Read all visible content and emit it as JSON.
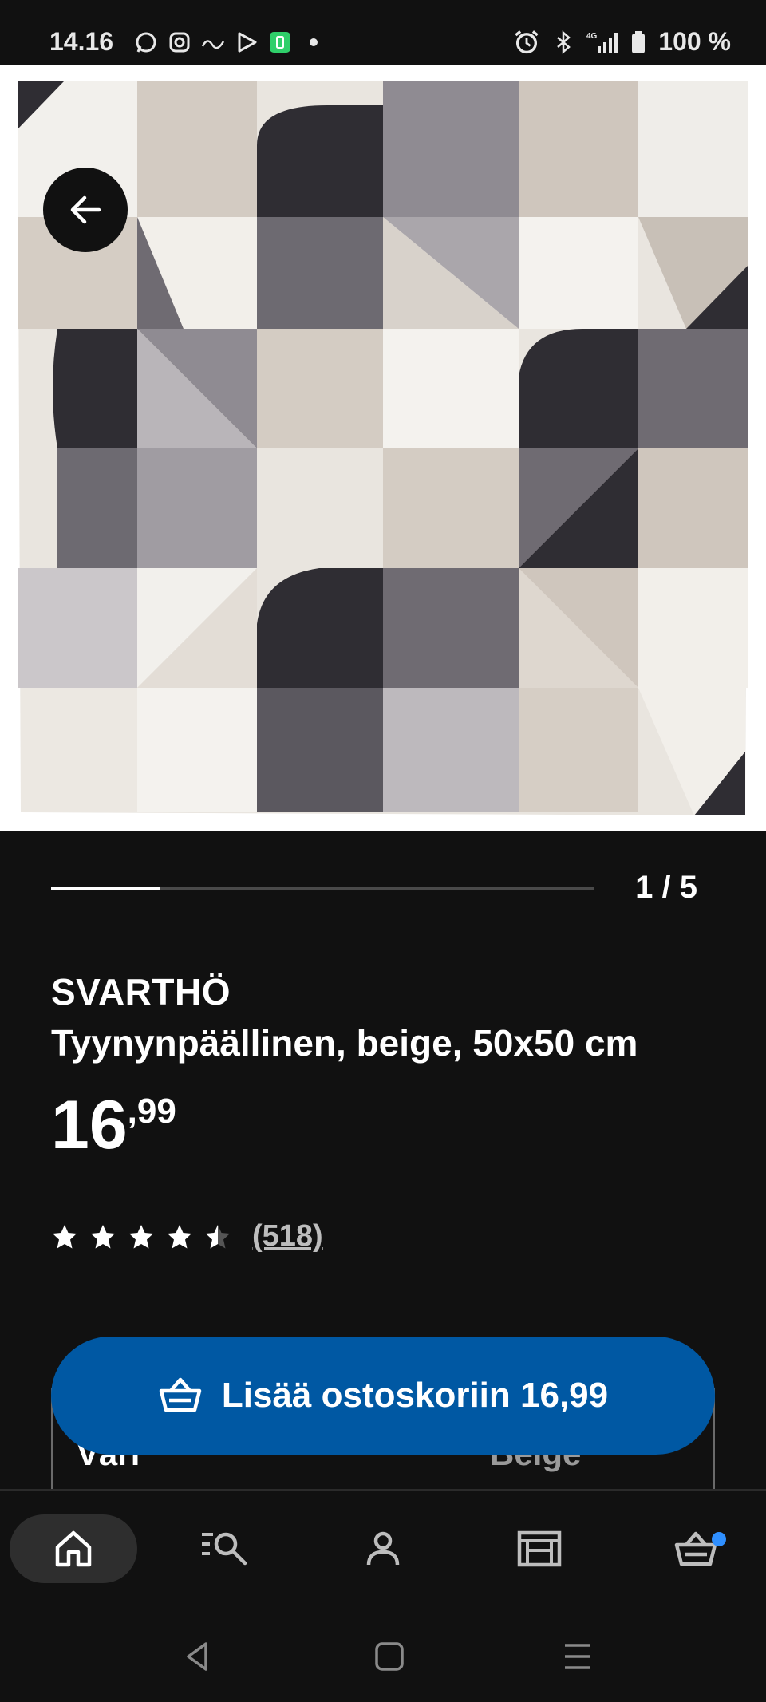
{
  "status_bar": {
    "time": "14.16",
    "left_icons": [
      "whatsapp-icon",
      "instagram-icon",
      "elisa-icon",
      "play-store-icon",
      "battery-saver-icon",
      "dot-icon"
    ],
    "right_icons": [
      "alarm-icon",
      "bluetooth-icon",
      "4g-signal-icon",
      "battery-icon"
    ],
    "network": "4G",
    "battery": "100 %"
  },
  "image": {
    "alt": "SVARTHÖ",
    "carousel_index": 1,
    "carousel_total": 5,
    "counter_text": "1 / 5",
    "progress_fraction": 0.2
  },
  "product": {
    "name": "SVARTHÖ",
    "description": "Tyynynpäällinen, beige, 50x50 cm",
    "price_int": "16",
    "price_dec": ",99",
    "rating": 4.5,
    "review_count": "(518)"
  },
  "variant": {
    "label": "Väri",
    "value": "Beige"
  },
  "cta": {
    "label": "Lisää ostoskoriin 16,99"
  },
  "bottom_nav": {
    "items": [
      "home-icon",
      "search-icon",
      "account-icon",
      "store-icon",
      "cart-icon"
    ],
    "active": "home-icon",
    "cart_badge_color": "#2f8fff"
  },
  "colors": {
    "background": "#111111",
    "accent": "#0058a3"
  }
}
